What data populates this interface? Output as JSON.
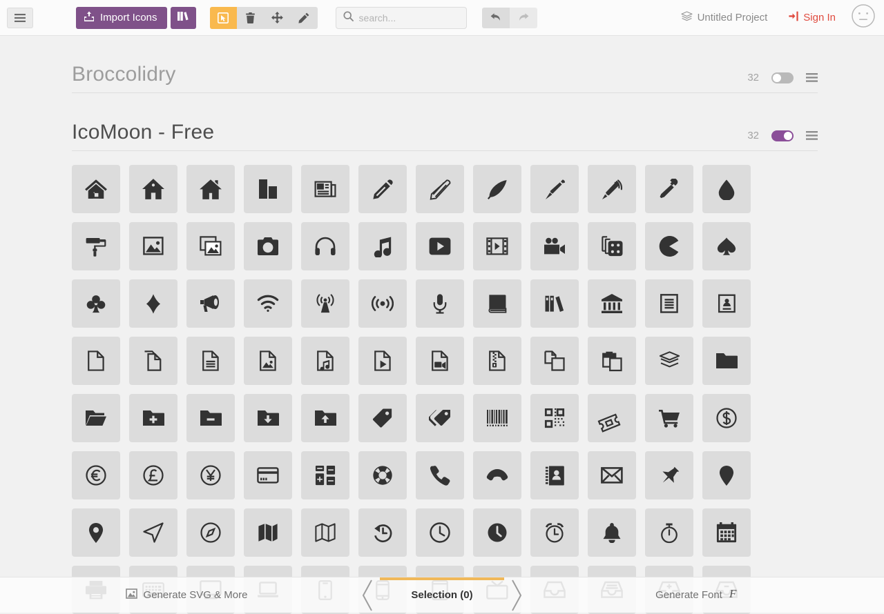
{
  "topbar": {
    "menu_icon": "hamburger-icon",
    "import_label": "Import Icons",
    "import_icon": "upload-box-icon",
    "library_icon": "books-icon",
    "tools": [
      {
        "name": "select-tool",
        "icon": "cursor-select-icon",
        "active": true
      },
      {
        "name": "delete-tool",
        "icon": "trash-icon",
        "active": false
      },
      {
        "name": "move-tool",
        "icon": "move-arrows-icon",
        "active": false
      },
      {
        "name": "edit-tool",
        "icon": "pencil-icon",
        "active": false
      }
    ],
    "search": {
      "value": "",
      "placeholder": "search...",
      "icon": "search-icon"
    },
    "undo_icon": "undo-arrow-icon",
    "redo_icon": "redo-arrow-icon",
    "project_label": "Untitled Project",
    "project_icon": "layers-icon",
    "signin_label": "Sign In",
    "signin_icon": "login-icon",
    "avatar_icon": "neutral-face-icon"
  },
  "sets": [
    {
      "title": "Broccolidry",
      "count": "32",
      "toggle_on": false,
      "menu_icon": "list-menu-icon"
    },
    {
      "title": "IcoMoon - Free",
      "count": "32",
      "toggle_on": true,
      "menu_icon": "list-menu-icon"
    }
  ],
  "icons": [
    "home-outline-icon",
    "home-door-icon",
    "home-solid-icon",
    "office-building-icon",
    "newspaper-icon",
    "pencil-icon",
    "pencil2-icon",
    "quill-icon",
    "pen-nib-icon",
    "pen-wireless-icon",
    "eyedropper-icon",
    "droplet-icon",
    "paint-roller-icon",
    "image-icon",
    "images-icon",
    "camera-icon",
    "headphones-icon",
    "music-note-icon",
    "play-video-icon",
    "film-strip-icon",
    "video-camera-icon",
    "dice-icon",
    "pacman-icon",
    "spades-icon",
    "clubs-icon",
    "diamonds-icon",
    "bullhorn-icon",
    "wifi-icon",
    "radio-tower-icon",
    "podcast-icon",
    "microphone-icon",
    "book-icon",
    "books-icon",
    "library-icon",
    "file-text-icon",
    "profile-card-icon",
    "file-empty-icon",
    "files-empty-icon",
    "file-text2-icon",
    "file-picture-icon",
    "file-music-icon",
    "file-play-icon",
    "file-video-icon",
    "file-zip-icon",
    "copy-icon",
    "paste-icon",
    "stack-icon",
    "folder-icon",
    "folder-open-icon",
    "folder-plus-icon",
    "folder-minus-icon",
    "folder-download-icon",
    "folder-upload-icon",
    "price-tag-icon",
    "price-tags-icon",
    "barcode-icon",
    "qrcode-icon",
    "ticket-icon",
    "cart-icon",
    "coin-dollar-icon",
    "coin-euro-icon",
    "coin-pound-icon",
    "coin-yen-icon",
    "credit-card-icon",
    "calculator-icon",
    "lifebuoy-icon",
    "phone-icon",
    "phone-hang-up-icon",
    "address-book-icon",
    "envelope-icon",
    "pushpin-icon",
    "location-icon",
    "location2-icon",
    "compass-arrow-icon",
    "compass2-icon",
    "map-solid-icon",
    "map-outline-icon",
    "history-icon",
    "clock-outline-icon",
    "clock-solid-icon",
    "alarm-icon",
    "bell-icon",
    "stopwatch-icon",
    "calendar-icon",
    "printer-icon",
    "keyboard-icon",
    "display-icon",
    "laptop-icon",
    "mobile-icon",
    "mobile2-icon",
    "tablet-icon",
    "tv-icon",
    "drawer-icon",
    "drawer2-icon",
    "box-add-icon",
    "box-remove-icon"
  ],
  "footer": {
    "left_label": "Generate SVG & More",
    "left_icon": "image-icon",
    "center_label": "Selection (0)",
    "right_label": "Generate Font",
    "right_icon": "font-f-icon"
  },
  "colors": {
    "purple": "#7f5189",
    "toggle_on": "#8b4f99",
    "accent_orange": "#f9b94e",
    "footer_bar": "#f0b859",
    "signin_red": "#e04b3f",
    "tile_bg": "#dcdcdc",
    "icon_fill": "#333333",
    "page_bg": "#f1f1f1"
  }
}
